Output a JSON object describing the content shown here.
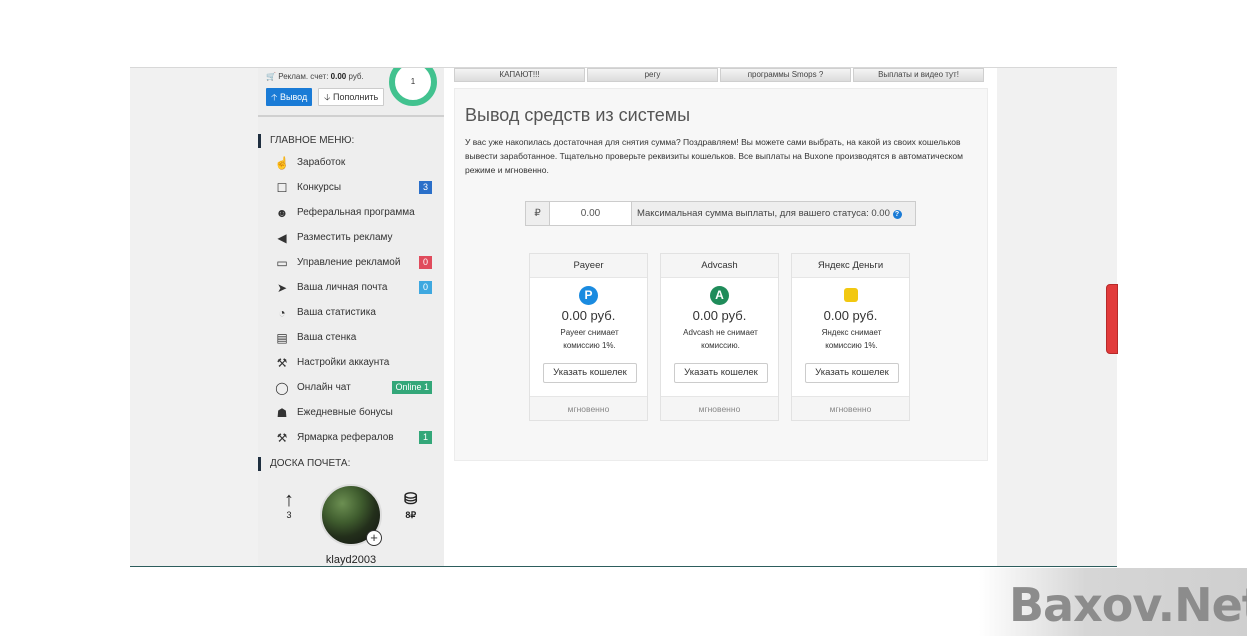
{
  "sidebar": {
    "ad_balance_label": "Реклам. счет:",
    "ad_balance_value": "0.00",
    "ad_balance_unit": "руб.",
    "withdraw_label": "Вывод",
    "topup_label": "Пополнить",
    "level_value": "1",
    "main_menu_title": "ГЛАВНОЕ МЕНЮ:",
    "menu": [
      {
        "label": "Заработок",
        "icon": "hand-pointer-icon"
      },
      {
        "label": "Конкурсы",
        "icon": "bookmark-icon",
        "badge": "3",
        "badge_color": "#2a6fc9"
      },
      {
        "label": "Реферальная программа",
        "icon": "users-icon"
      },
      {
        "label": "Разместить рекламу",
        "icon": "megaphone-icon"
      },
      {
        "label": "Управление рекламой",
        "icon": "folder-icon",
        "badge": "0",
        "badge_color": "#e04b5c"
      },
      {
        "label": "Ваша личная почта",
        "icon": "paper-plane-icon",
        "badge": "0",
        "badge_color": "#3ea8e0"
      },
      {
        "label": "Ваша статистика",
        "icon": "pie-chart-icon"
      },
      {
        "label": "Ваша стенка",
        "icon": "id-card-icon"
      },
      {
        "label": "Настройки аккаунта",
        "icon": "wrench-icon"
      },
      {
        "label": "Онлайн чат",
        "icon": "chat-icon",
        "badge": "Online 1",
        "badge_color": "#33a779"
      },
      {
        "label": "Ежедневные бонусы",
        "icon": "gift-icon"
      },
      {
        "label": "Ярмарка рефералов",
        "icon": "gavel-icon",
        "badge": "1",
        "badge_color": "#33a779"
      }
    ],
    "honor_title": "ДОСКА ПОЧЕТА:",
    "honor_up_value": "3",
    "honor_coins_value": "8₽",
    "honor_username": "klayd2003"
  },
  "tabs": [
    "КАПАЮТ!!!",
    "регу",
    "программы Smops ?",
    "Выплаты и видео тут!"
  ],
  "main": {
    "title": "Вывод средств из системы",
    "description": "У вас уже накопилась достаточная для снятия сумма? Поздравляем! Вы можете сами выбрать, на какой из своих кошельков вывести заработанное. Тщательно проверьте реквизиты кошельков. Все выплаты на Buxone производятся в автоматическом режиме и мгновенно.",
    "currency_symbol": "₽",
    "amount_value": "0.00",
    "max_info": "Максимальная сумма выплаты, для вашего статуса: 0.00",
    "help_icon": "question-circle-icon"
  },
  "wallets": [
    {
      "name": "Payeer",
      "logo": "P",
      "logo_color": "#1a8be0",
      "sum": "0.00 руб.",
      "note": "Payeer снимает комиссию 1%.",
      "button": "Указать кошелек",
      "footer": "мгновенно"
    },
    {
      "name": "Advcash",
      "logo": "A",
      "logo_color": "#1f8c5a",
      "sum": "0.00 руб.",
      "note": "Advcash не снимает комиссию.",
      "button": "Указать кошелек",
      "footer": "мгновенно"
    },
    {
      "name": "Яндекс Деньги",
      "logo": "",
      "logo_color": "#f2c811",
      "sum": "0.00 руб.",
      "note": "Яндекс снимает комиссию 1%.",
      "button": "Указать кошелек",
      "footer": "мгновенно"
    }
  ],
  "watermark": "Baxov.Net",
  "colors": {
    "accent": "#1a7bd6",
    "ring": "#42c28f"
  }
}
